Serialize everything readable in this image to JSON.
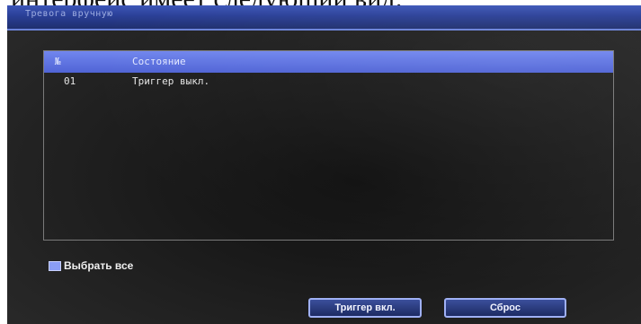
{
  "document": {
    "caption": "интерфейс имеет следующий вид:"
  },
  "window": {
    "title": "Тревога вручную"
  },
  "alarm_list": {
    "columns": {
      "number": "№",
      "state": "Состояние"
    },
    "rows": [
      {
        "number": "01",
        "state": "Триггер выкл."
      }
    ]
  },
  "select_all": {
    "label": "Выбрать все",
    "checked": true
  },
  "buttons": {
    "trigger_on": "Триггер вкл.",
    "reset": "Сброс"
  },
  "colors": {
    "title_bar": "#2a3f96",
    "list_header": "#5f74e2",
    "button_border": "#9fb0f5",
    "background": "#1c1c1c"
  }
}
